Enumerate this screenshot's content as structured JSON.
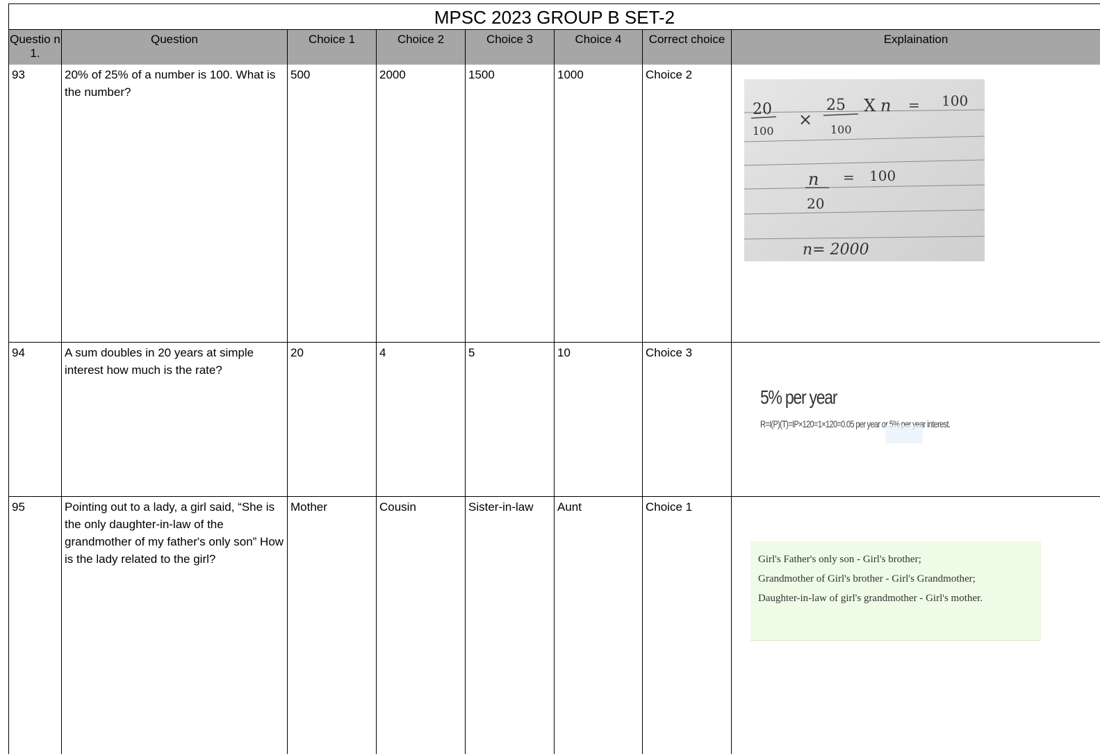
{
  "title": "MPSC 2023 GROUP B SET-2",
  "headers": {
    "num": "Questio n 1.",
    "question": "Question",
    "c1": "Choice 1",
    "c2": "Choice 2",
    "c3": "Choice 3",
    "c4": "Choice 4",
    "correct": "Correct choice",
    "explain": "Explaination"
  },
  "rows": [
    {
      "num": "93",
      "question": "20% of 25% of a number is 100. What is the number?",
      "c1": "500",
      "c2": "2000",
      "c3": "1500",
      "c4": "1000",
      "correct": "Choice 2"
    },
    {
      "num": "94",
      "question": "A sum doubles in 20 years at simple interest how much is the rate?",
      "c1": "20",
      "c2": "4",
      "c3": "5",
      "c4": "10",
      "correct": "Choice 3"
    },
    {
      "num": "95",
      "question": "Pointing out to a lady, a girl said, “She is the only daughter-in-law of the grandmother of my father's only son” How is the lady related to the girl?",
      "c1": "Mother",
      "c2": "Cousin",
      "c3": "Sister-in-law",
      "c4": "Aunt",
      "correct": "Choice 1"
    }
  ],
  "explanations": {
    "q93": {
      "line1_left": "20",
      "line1_mid": "25",
      "line1_x": "X",
      "line1_n": "n",
      "line1_eq": "=",
      "line1_val": "100",
      "line2_left": "100",
      "line2_mid": "100",
      "line3_n": "n",
      "line3_eq": "=",
      "line3_val": "100",
      "line4": "20",
      "line5": "n= 2000"
    },
    "q94": {
      "headline": "5% per year",
      "formula": "R=I(P)(T)=IP×120=1×120=0.05 per year or 5% per year interest."
    },
    "q95": {
      "line1": "Girl's Father's only son - Girl's brother;",
      "line2": "Grandmother of Girl's brother - Girl's Grandmother;",
      "line3": "Daughter-in-law of girl's grandmother - Girl's mother."
    }
  },
  "colors": {
    "header_bg": "#a6a6a6",
    "highlight": "#e8f1fc",
    "green_box": "#eefbe6"
  }
}
